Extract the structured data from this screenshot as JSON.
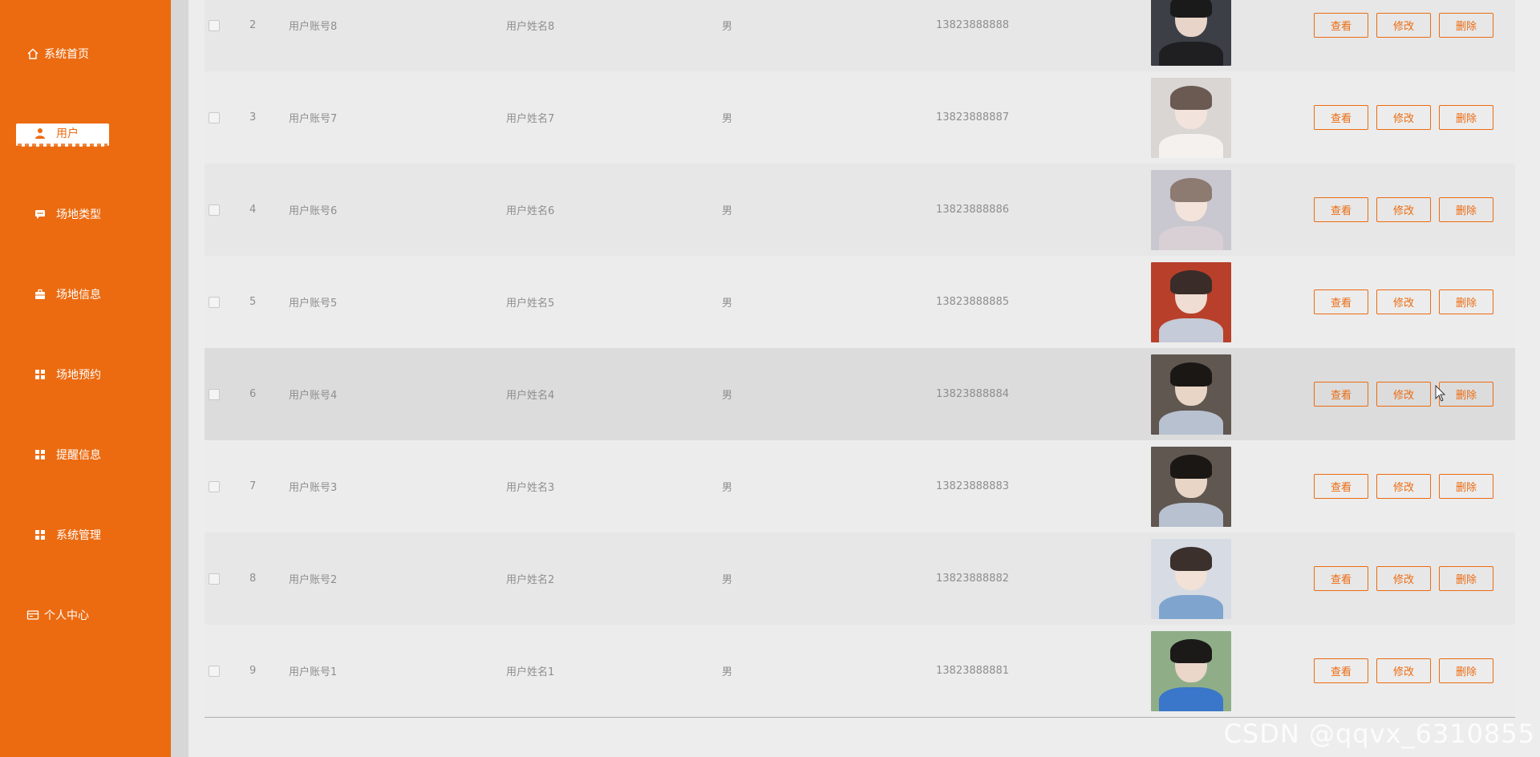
{
  "sidebar": {
    "items": [
      {
        "label": "系统首页",
        "icon": "home-icon",
        "type": "flat"
      },
      {
        "label": "用户",
        "icon": "user-icon",
        "type": "sub",
        "active": true
      },
      {
        "label": "场地类型",
        "icon": "chat-icon",
        "type": "sub"
      },
      {
        "label": "场地信息",
        "icon": "briefcase-icon",
        "type": "sub"
      },
      {
        "label": "场地预约",
        "icon": "grid-icon",
        "type": "sub"
      },
      {
        "label": "提醒信息",
        "icon": "grid-icon",
        "type": "sub"
      },
      {
        "label": "系统管理",
        "icon": "grid-icon",
        "type": "sub"
      },
      {
        "label": "个人中心",
        "icon": "id-card-icon",
        "type": "flat"
      }
    ]
  },
  "table": {
    "rows": [
      {
        "index": "2",
        "account": "用户账号8",
        "name": "用户姓名8",
        "gender": "男",
        "phone": "13823888888",
        "avatar": "photo-dark-hoodie"
      },
      {
        "index": "3",
        "account": "用户账号7",
        "name": "用户姓名7",
        "gender": "男",
        "phone": "13823888887",
        "avatar": "photo-light-girl"
      },
      {
        "index": "4",
        "account": "用户账号6",
        "name": "用户姓名6",
        "gender": "男",
        "phone": "13823888886",
        "avatar": "photo-soft-girl"
      },
      {
        "index": "5",
        "account": "用户账号5",
        "name": "用户姓名5",
        "gender": "男",
        "phone": "13823888885",
        "avatar": "photo-red-bg-boy"
      },
      {
        "index": "6",
        "account": "用户账号4",
        "name": "用户姓名4",
        "gender": "男",
        "phone": "13823888884",
        "avatar": "photo-mirror-boy"
      },
      {
        "index": "7",
        "account": "用户账号3",
        "name": "用户姓名3",
        "gender": "男",
        "phone": "13823888883",
        "avatar": "photo-mirror-boy"
      },
      {
        "index": "8",
        "account": "用户账号2",
        "name": "用户姓名2",
        "gender": "男",
        "phone": "13823888882",
        "avatar": "photo-blue-girl"
      },
      {
        "index": "9",
        "account": "用户账号1",
        "name": "用户姓名1",
        "gender": "男",
        "phone": "13823888881",
        "avatar": "photo-blue-boy"
      }
    ],
    "actions": {
      "view": "查看",
      "edit": "修改",
      "delete": "删除"
    }
  },
  "watermark": "CSDN @qqvx_6310855",
  "colors": {
    "accent": "#ec6b11",
    "sidebar": "#ec6b11"
  }
}
